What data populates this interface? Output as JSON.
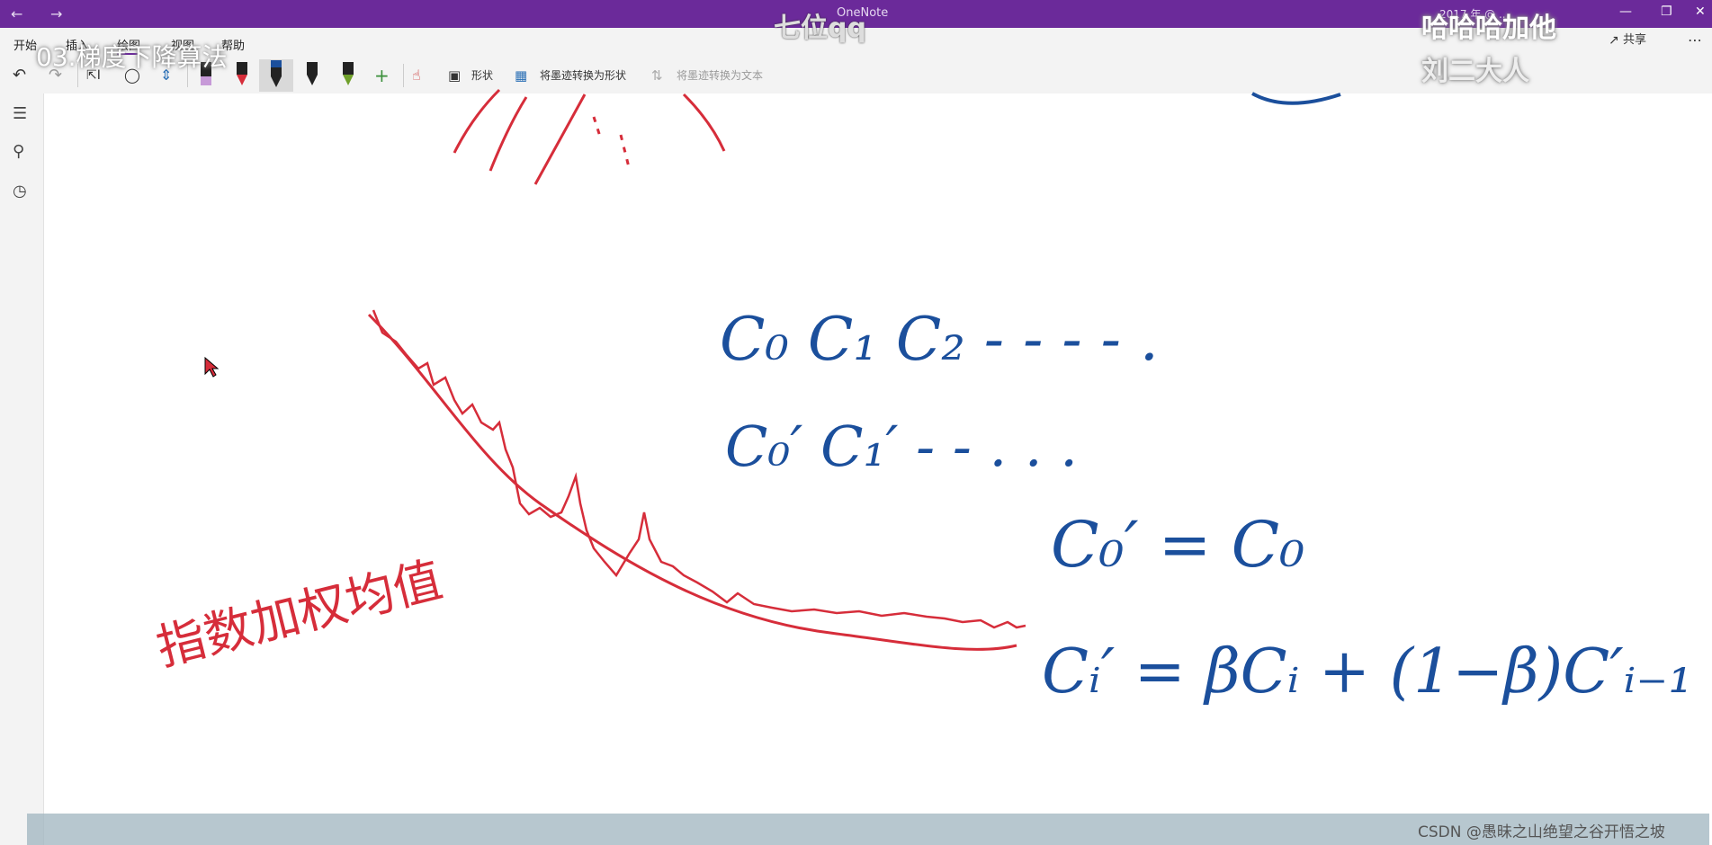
{
  "window": {
    "app_title": "OneNote",
    "doc_info": "2017 年 @ ...",
    "back_icon": "arrow-left-icon",
    "forward_icon": "arrow-right-icon"
  },
  "ribbon": {
    "tabs": [
      {
        "label": "开始"
      },
      {
        "label": "插入"
      },
      {
        "label": "绘图"
      },
      {
        "label": "视图"
      },
      {
        "label": "帮助"
      }
    ],
    "active_tab": "绘图",
    "shapes_label": "形状",
    "ink_to_shape_label": "将墨迹转换为形状",
    "ink_to_text_label": "将墨迹转换为文本",
    "share_label": "共享",
    "pen_colors": [
      "#c79ad8",
      "#d62d3a",
      "#1b4f9c",
      "#222222",
      "#6fa02a"
    ]
  },
  "overlays": {
    "video_title": "03.梯度下降算法",
    "watermark_center": "七位qq",
    "watermark_right_1": "哈哈哈加他",
    "watermark_right_2": "刘二大人"
  },
  "ink": {
    "red_label": "指数加权均值",
    "row1": "C₀   C₁  C₂ - - - - .",
    "row2": "C₀′   C₁′ - - . . .",
    "eq1": "C₀′ = C₀",
    "eq2": "Cᵢ′ = βCᵢ + (1−β)C′ᵢ₋₁",
    "red_color": "#d62d3a",
    "blue_color": "#1b4f9c"
  },
  "footer": {
    "csdn": "CSDN @愚昧之山绝望之谷开悟之坡"
  }
}
